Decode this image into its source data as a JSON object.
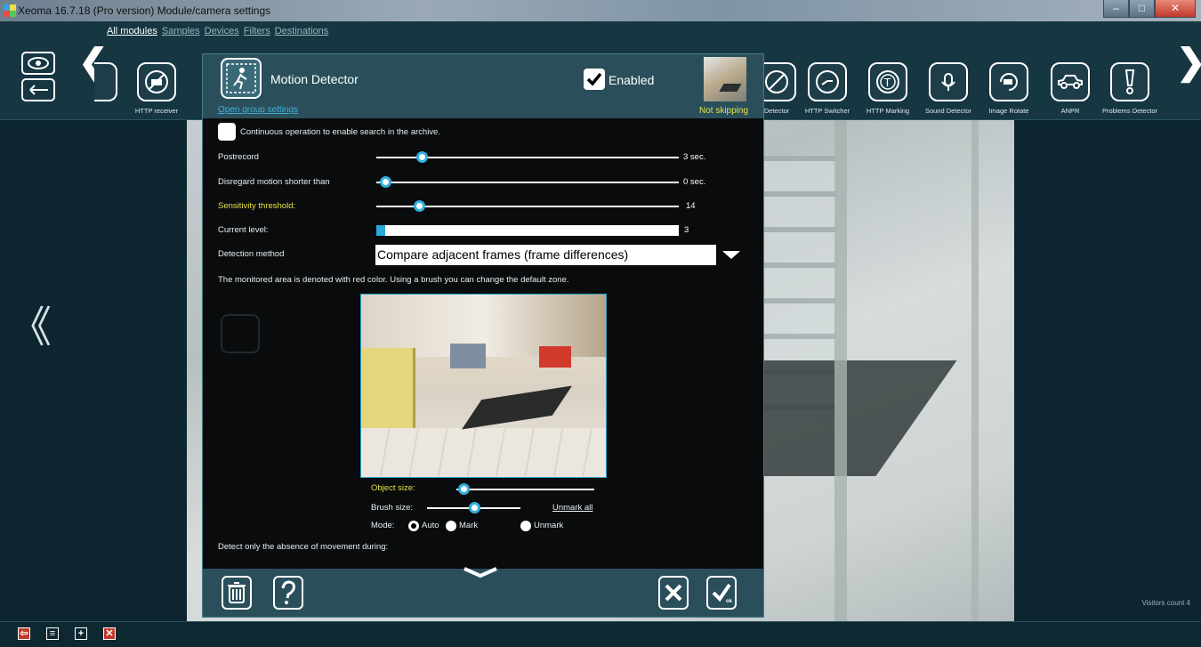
{
  "window": {
    "title": "Xeoma 16.7.18 (Pro version) Module/camera settings",
    "min": "–",
    "max": "□",
    "close": "✕"
  },
  "tabs": [
    {
      "label": "All modules"
    },
    {
      "label": "Samples"
    },
    {
      "label": "Devices"
    },
    {
      "label": "Filters"
    },
    {
      "label": "Destinations"
    }
  ],
  "modules": [
    {
      "label": "HTTP receiver",
      "icon": "http-receiver-icon"
    },
    {
      "label": "Detector",
      "icon": "detector-icon"
    },
    {
      "label": "HTTP Switcher",
      "icon": "http-switcher-icon"
    },
    {
      "label": "HTTP Marking",
      "icon": "http-marking-icon"
    },
    {
      "label": "Sound Detector",
      "icon": "sound-detector-icon"
    },
    {
      "label": "Image Rotate",
      "icon": "image-rotate-icon"
    },
    {
      "label": "ANPR",
      "icon": "anpr-icon"
    },
    {
      "label": "Problems Detector",
      "icon": "problems-detector-icon"
    }
  ],
  "dialog": {
    "title": "Motion Detector",
    "group_link": "Open group settings",
    "enabled_label": "Enabled",
    "skip_status": "Not skipping",
    "continuous_label": "Continuous operation to enable search in the archive.",
    "postrecord": {
      "label": "Postrecord",
      "value": "3 sec.",
      "level": 0.15
    },
    "disregard": {
      "label": "Disregard motion shorter than",
      "value": "0 sec.",
      "level": 0.03
    },
    "sensitivity": {
      "label": "Sensitivity threshold:",
      "value": "14",
      "level": 0.14
    },
    "current_level": {
      "label": "Current level:",
      "value": "3",
      "level": 0.03
    },
    "detection_method": {
      "label": "Detection method",
      "selected": "Compare adjacent frames (frame differences)"
    },
    "zone_description": "The monitored area is denoted with red color. Using a brush you can change the default zone.",
    "object_size": {
      "label": "Object size:",
      "level": 0.05
    },
    "brush_size": {
      "label": "Brush size:",
      "level": 0.5
    },
    "unmark_all": "Unmark all",
    "mode": {
      "label": "Mode:",
      "auto": "Auto",
      "mark": "Mark",
      "unmark": "Unmark"
    },
    "absence_label": "Detect only the absence of movement during:"
  },
  "visitors": "Visitors count 4",
  "colors": {
    "accent": "#2fb0de",
    "highlight": "#e8e14a",
    "panel": "#2a4f5b"
  }
}
